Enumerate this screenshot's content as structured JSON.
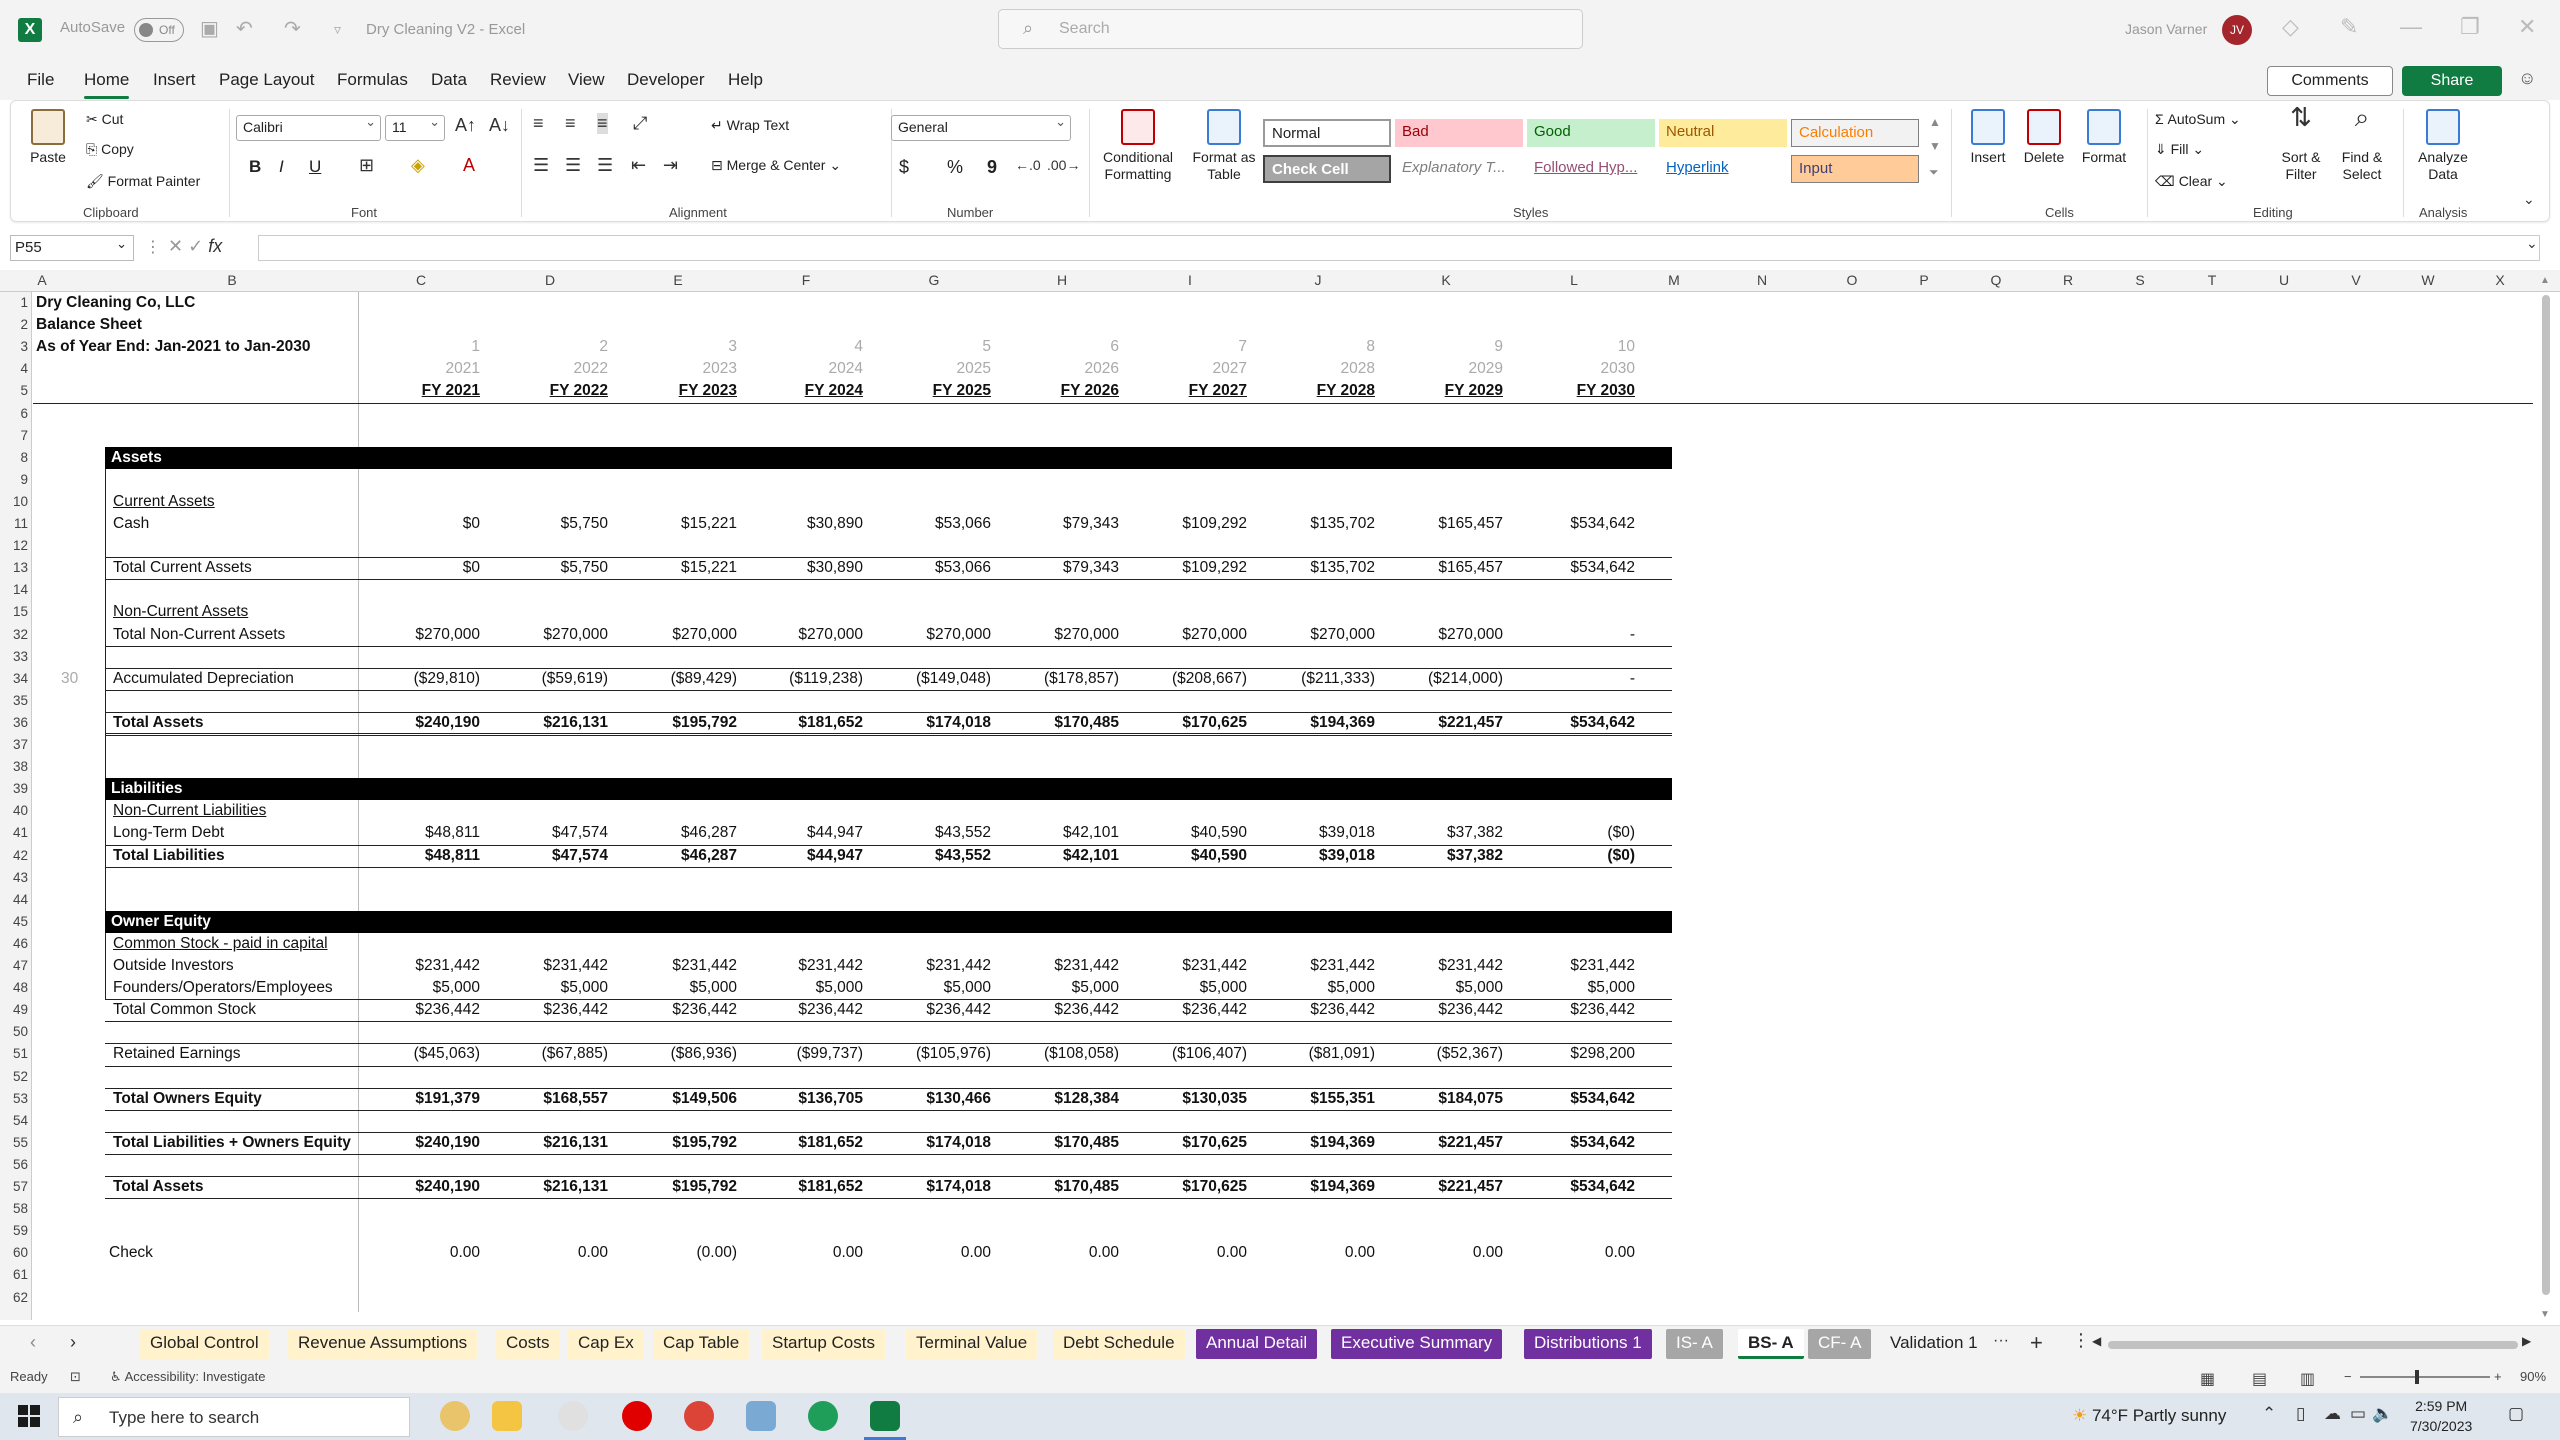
{
  "title_bar": {
    "autosave_label": "AutoSave",
    "autosave_state": "Off",
    "document_title": "Dry Cleaning V2  -  Excel",
    "search_placeholder": "Search",
    "user_name": "Jason Varner",
    "user_initials": "JV"
  },
  "menu": {
    "items": [
      "File",
      "Home",
      "Insert",
      "Page Layout",
      "Formulas",
      "Data",
      "Review",
      "View",
      "Developer",
      "Help"
    ],
    "active": "Home",
    "comments_label": "Comments",
    "share_label": "Share"
  },
  "ribbon": {
    "clipboard": {
      "paste": "Paste",
      "cut": "Cut",
      "copy": "Copy",
      "format_painter": "Format Painter",
      "label": "Clipboard"
    },
    "font": {
      "name": "Calibri",
      "size": "11",
      "label": "Font",
      "bold": "B",
      "italic": "I",
      "underline": "U"
    },
    "alignment": {
      "wrap_text": "Wrap Text",
      "merge_center": "Merge & Center",
      "label": "Alignment"
    },
    "number": {
      "format": "General",
      "label": "Number",
      "currency": "$",
      "percent": "%",
      "comma": "9"
    },
    "styles": {
      "conditional_formatting": "Conditional Formatting",
      "format_as_table": "Format as Table",
      "cells": [
        {
          "name": "Normal",
          "bg": "#ffffff",
          "fg": "#000000"
        },
        {
          "name": "Bad",
          "bg": "#ffc7ce",
          "fg": "#9c0006"
        },
        {
          "name": "Good",
          "bg": "#c6efce",
          "fg": "#006100"
        },
        {
          "name": "Neutral",
          "bg": "#ffeb9c",
          "fg": "#9c5700"
        },
        {
          "name": "Calculation",
          "bg": "#f2f2f2",
          "fg": "#fa7d00"
        },
        {
          "name": "Check Cell",
          "bg": "#a5a5a5",
          "fg": "#ffffff"
        },
        {
          "name": "Explanatory T...",
          "bg": "#ffffff",
          "fg": "#7f7f7f"
        },
        {
          "name": "Followed Hyp...",
          "bg": "#ffffff",
          "fg": "#954f72"
        },
        {
          "name": "Hyperlink",
          "bg": "#ffffff",
          "fg": "#0563c1"
        },
        {
          "name": "Input",
          "bg": "#ffcc99",
          "fg": "#3f3f76"
        }
      ],
      "label": "Styles"
    },
    "cells_group": {
      "insert": "Insert",
      "delete": "Delete",
      "format": "Format",
      "label": "Cells"
    },
    "editing": {
      "autosum": "AutoSum",
      "fill": "Fill",
      "clear": "Clear",
      "sort_filter": "Sort & Filter",
      "find_select": "Find & Select",
      "label": "Editing"
    },
    "analysis": {
      "analyze_data": "Analyze Data",
      "label": "Analysis"
    }
  },
  "formula_bar": {
    "name_box": "P55",
    "fx": "fx",
    "content": ""
  },
  "columns": [
    "A",
    "B",
    "C",
    "D",
    "E",
    "F",
    "G",
    "H",
    "I",
    "J",
    "K",
    "L",
    "M",
    "N",
    "O",
    "P",
    "Q",
    "R",
    "S",
    "T",
    "U",
    "V",
    "W",
    "X"
  ],
  "row_numbers": [
    "1",
    "2",
    "3",
    "4",
    "5",
    "6",
    "7",
    "8",
    "9",
    "10",
    "11",
    "12",
    "13",
    "14",
    "15",
    "32",
    "33",
    "34",
    "35",
    "36",
    "37",
    "38",
    "39",
    "40",
    "41",
    "42",
    "43",
    "44",
    "45",
    "46",
    "47",
    "48",
    "49",
    "50",
    "51",
    "52",
    "53",
    "54",
    "55",
    "56",
    "57",
    "58",
    "59",
    "60",
    "61",
    "62"
  ],
  "sheet": {
    "company": "Dry Cleaning Co, LLC",
    "statement": "Balance Sheet",
    "as_of": "As of Year End: Jan-2021 to Jan-2030",
    "period_numbers": [
      "1",
      "2",
      "3",
      "4",
      "5",
      "6",
      "7",
      "8",
      "9",
      "10"
    ],
    "years": [
      "2021",
      "2022",
      "2023",
      "2024",
      "2025",
      "2026",
      "2027",
      "2028",
      "2029",
      "2030"
    ],
    "fy_headers": [
      "FY 2021",
      "FY 2022",
      "FY 2023",
      "FY 2024",
      "FY 2025",
      "FY 2026",
      "FY 2027",
      "FY 2028",
      "FY 2029",
      "FY 2030"
    ],
    "row34_col_a": "30",
    "sections": {
      "assets": "Assets",
      "current_assets": "Current Assets",
      "non_current_assets": "Non-Current Assets",
      "liabilities": "Liabilities",
      "non_current_liabilities": "Non-Current Liabilities",
      "owner_equity": "Owner Equity",
      "common_stock": "Common Stock - paid in capital"
    },
    "rows": {
      "cash": {
        "label": "Cash",
        "values": [
          "$0",
          "$5,750",
          "$15,221",
          "$30,890",
          "$53,066",
          "$79,343",
          "$109,292",
          "$135,702",
          "$165,457",
          "$534,642"
        ]
      },
      "total_current_assets": {
        "label": "Total Current Assets",
        "values": [
          "$0",
          "$5,750",
          "$15,221",
          "$30,890",
          "$53,066",
          "$79,343",
          "$109,292",
          "$135,702",
          "$165,457",
          "$534,642"
        ]
      },
      "total_non_current_assets": {
        "label": "Total Non-Current Assets",
        "values": [
          "$270,000",
          "$270,000",
          "$270,000",
          "$270,000",
          "$270,000",
          "$270,000",
          "$270,000",
          "$270,000",
          "$270,000",
          "-"
        ]
      },
      "accumulated_depreciation": {
        "label": "Accumulated Depreciation",
        "values": [
          "($29,810)",
          "($59,619)",
          "($89,429)",
          "($119,238)",
          "($149,048)",
          "($178,857)",
          "($208,667)",
          "($211,333)",
          "($214,000)",
          "-"
        ]
      },
      "total_assets": {
        "label": "Total Assets",
        "values": [
          "$240,190",
          "$216,131",
          "$195,792",
          "$181,652",
          "$174,018",
          "$170,485",
          "$170,625",
          "$194,369",
          "$221,457",
          "$534,642"
        ]
      },
      "long_term_debt": {
        "label": "Long-Term Debt",
        "values": [
          "$48,811",
          "$47,574",
          "$46,287",
          "$44,947",
          "$43,552",
          "$42,101",
          "$40,590",
          "$39,018",
          "$37,382",
          "($0)"
        ]
      },
      "total_liabilities": {
        "label": "Total Liabilities",
        "values": [
          "$48,811",
          "$47,574",
          "$46,287",
          "$44,947",
          "$43,552",
          "$42,101",
          "$40,590",
          "$39,018",
          "$37,382",
          "($0)"
        ]
      },
      "outside_investors": {
        "label": "Outside Investors",
        "values": [
          "$231,442",
          "$231,442",
          "$231,442",
          "$231,442",
          "$231,442",
          "$231,442",
          "$231,442",
          "$231,442",
          "$231,442",
          "$231,442"
        ]
      },
      "founders": {
        "label": "Founders/Operators/Employees",
        "values": [
          "$5,000",
          "$5,000",
          "$5,000",
          "$5,000",
          "$5,000",
          "$5,000",
          "$5,000",
          "$5,000",
          "$5,000",
          "$5,000"
        ]
      },
      "total_common_stock": {
        "label": "Total Common Stock",
        "values": [
          "$236,442",
          "$236,442",
          "$236,442",
          "$236,442",
          "$236,442",
          "$236,442",
          "$236,442",
          "$236,442",
          "$236,442",
          "$236,442"
        ]
      },
      "retained_earnings": {
        "label": "Retained Earnings",
        "values": [
          "($45,063)",
          "($67,885)",
          "($86,936)",
          "($99,737)",
          "($105,976)",
          "($108,058)",
          "($106,407)",
          "($81,091)",
          "($52,367)",
          "$298,200"
        ]
      },
      "total_owners_equity": {
        "label": "Total Owners Equity",
        "values": [
          "$191,379",
          "$168,557",
          "$149,506",
          "$136,705",
          "$130,466",
          "$128,384",
          "$130,035",
          "$155,351",
          "$184,075",
          "$534,642"
        ]
      },
      "total_liab_equity": {
        "label": "Total Liabilities + Owners Equity",
        "values": [
          "$240,190",
          "$216,131",
          "$195,792",
          "$181,652",
          "$174,018",
          "$170,485",
          "$170,625",
          "$194,369",
          "$221,457",
          "$534,642"
        ]
      },
      "total_assets_2": {
        "label": "Total Assets",
        "values": [
          "$240,190",
          "$216,131",
          "$195,792",
          "$181,652",
          "$174,018",
          "$170,485",
          "$170,625",
          "$194,369",
          "$221,457",
          "$534,642"
        ]
      },
      "check": {
        "label": "Check",
        "values": [
          "0.00",
          "0.00",
          "(0.00)",
          "0.00",
          "0.00",
          "0.00",
          "0.00",
          "0.00",
          "0.00",
          "0.00"
        ]
      }
    }
  },
  "sheet_tabs": [
    {
      "name": "Global Control",
      "style": "yellow"
    },
    {
      "name": "Revenue Assumptions",
      "style": "yellow"
    },
    {
      "name": "Costs",
      "style": "yellow"
    },
    {
      "name": "Cap Ex",
      "style": "yellow"
    },
    {
      "name": "Cap Table",
      "style": "yellow"
    },
    {
      "name": "Startup Costs",
      "style": "yellow"
    },
    {
      "name": "Terminal Value",
      "style": "yellow"
    },
    {
      "name": "Debt Schedule",
      "style": "yellow"
    },
    {
      "name": "Annual Detail",
      "style": "purple"
    },
    {
      "name": "Executive Summary",
      "style": "purple"
    },
    {
      "name": "Distributions 1",
      "style": "purple"
    },
    {
      "name": "IS- A",
      "style": "gray"
    },
    {
      "name": "BS- A",
      "style": "active"
    },
    {
      "name": "CF- A",
      "style": "gray"
    },
    {
      "name": "Validation 1",
      "style": "plain"
    }
  ],
  "status_bar": {
    "ready": "Ready",
    "accessibility": "Accessibility: Investigate",
    "zoom": "90%"
  },
  "taskbar": {
    "search_placeholder": "Type here to search",
    "weather": "74°F  Partly sunny",
    "time": "2:59 PM",
    "date": "7/30/2023"
  },
  "colors": {
    "excel_green": "#107c41",
    "tab_yellow": "#fff2cc",
    "tab_purple": "#7030a0",
    "tab_gray": "#a6a6a6"
  }
}
